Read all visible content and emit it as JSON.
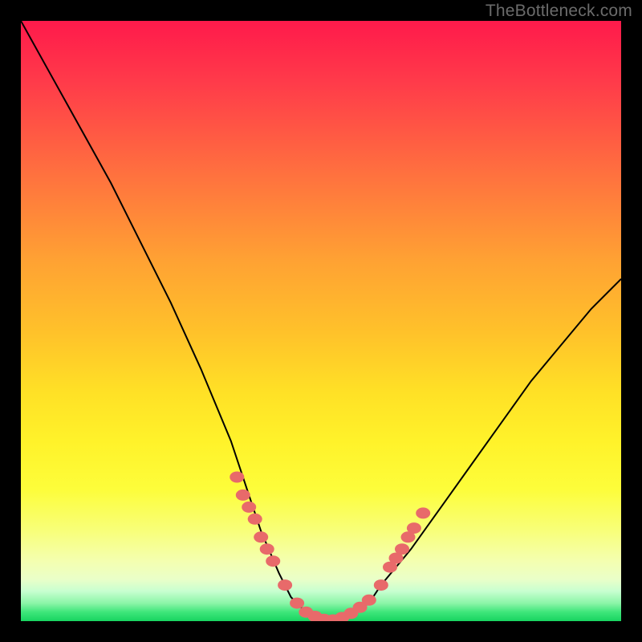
{
  "watermark": "TheBottleneck.com",
  "chart_data": {
    "type": "line",
    "title": "",
    "xlabel": "",
    "ylabel": "",
    "xlim": [
      0,
      100
    ],
    "ylim": [
      0,
      100
    ],
    "series": [
      {
        "name": "bottleneck-curve",
        "x": [
          0,
          5,
          10,
          15,
          20,
          25,
          30,
          35,
          38,
          40,
          43,
          45,
          48,
          50,
          53,
          55,
          58,
          60,
          65,
          70,
          75,
          80,
          85,
          90,
          95,
          100
        ],
        "y": [
          100,
          91,
          82,
          73,
          63,
          53,
          42,
          30,
          21,
          15,
          8,
          4,
          1,
          0,
          0,
          1,
          3,
          6,
          12,
          19,
          26,
          33,
          40,
          46,
          52,
          57
        ]
      }
    ],
    "markers": [
      {
        "name": "left-cluster",
        "points": [
          {
            "x": 36,
            "y": 24
          },
          {
            "x": 37,
            "y": 21
          },
          {
            "x": 38,
            "y": 19
          },
          {
            "x": 39,
            "y": 17
          },
          {
            "x": 40,
            "y": 14
          },
          {
            "x": 41,
            "y": 12
          },
          {
            "x": 42,
            "y": 10
          },
          {
            "x": 44,
            "y": 6
          }
        ]
      },
      {
        "name": "bottom-cluster",
        "points": [
          {
            "x": 46,
            "y": 3
          },
          {
            "x": 47.5,
            "y": 1.5
          },
          {
            "x": 49,
            "y": 0.8
          },
          {
            "x": 50.5,
            "y": 0.3
          },
          {
            "x": 52,
            "y": 0.2
          },
          {
            "x": 53.5,
            "y": 0.6
          },
          {
            "x": 55,
            "y": 1.3
          },
          {
            "x": 56.5,
            "y": 2.3
          },
          {
            "x": 58,
            "y": 3.5
          }
        ]
      },
      {
        "name": "right-cluster",
        "points": [
          {
            "x": 60,
            "y": 6
          },
          {
            "x": 61.5,
            "y": 9
          },
          {
            "x": 62.5,
            "y": 10.5
          },
          {
            "x": 63.5,
            "y": 12
          },
          {
            "x": 64.5,
            "y": 14
          },
          {
            "x": 65.5,
            "y": 15.5
          },
          {
            "x": 67,
            "y": 18
          }
        ]
      }
    ],
    "colors": {
      "curve": "#000000",
      "marker_fill": "#e86a6a",
      "marker_stroke": "#d85858"
    }
  }
}
